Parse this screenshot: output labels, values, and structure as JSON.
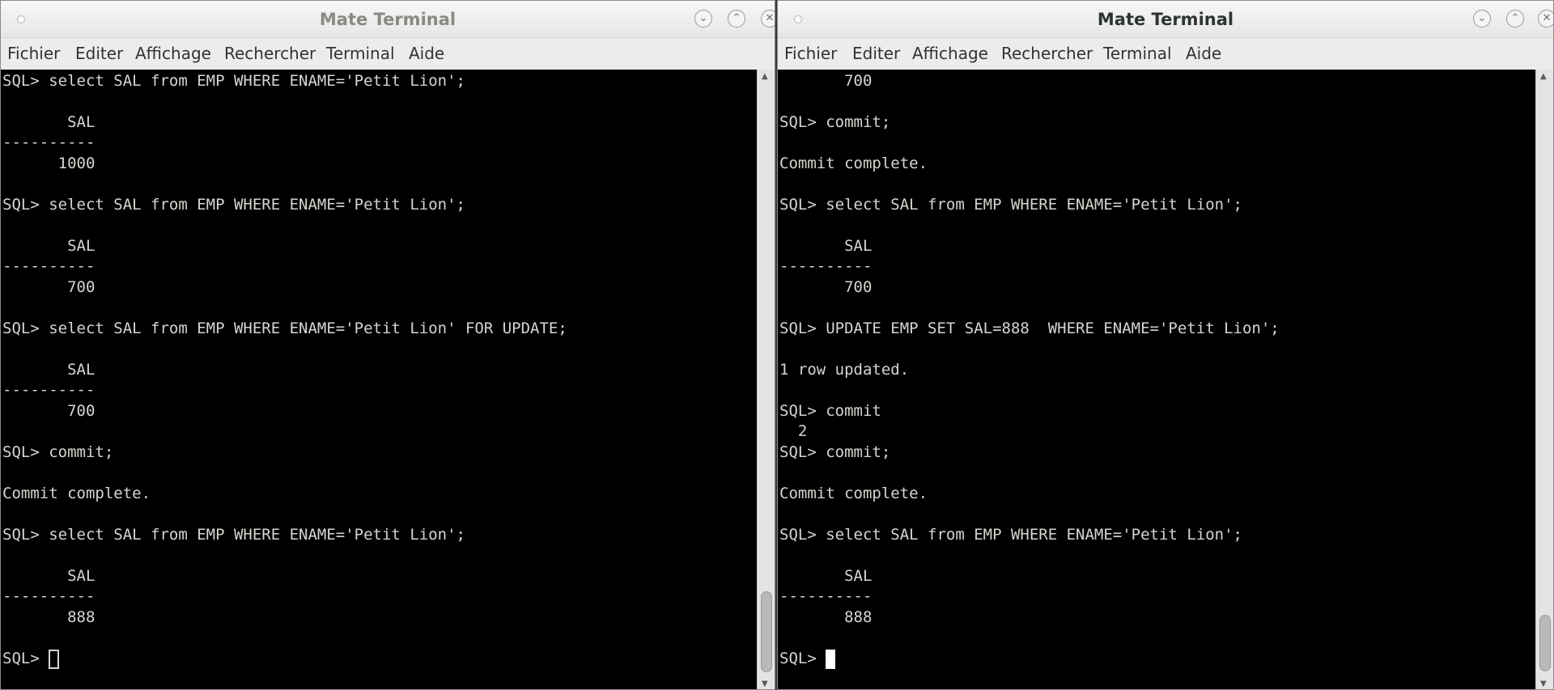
{
  "windows": {
    "left": {
      "title": "Mate Terminal",
      "menu": [
        "Fichier",
        "Editer",
        "Affichage",
        "Rechercher",
        "Terminal",
        "Aide"
      ],
      "lines": [
        "SQL> select SAL from EMP WHERE ENAME='Petit Lion';",
        "",
        "       SAL",
        "----------",
        "      1000",
        "",
        "SQL> select SAL from EMP WHERE ENAME='Petit Lion';",
        "",
        "       SAL",
        "----------",
        "       700",
        "",
        "SQL> select SAL from EMP WHERE ENAME='Petit Lion' FOR UPDATE;",
        "",
        "       SAL",
        "----------",
        "       700",
        "",
        "SQL> commit;",
        "",
        "Commit complete.",
        "",
        "SQL> select SAL from EMP WHERE ENAME='Petit Lion';",
        "",
        "       SAL",
        "----------",
        "       888",
        "",
        "SQL> "
      ]
    },
    "right": {
      "title": "Mate Terminal",
      "menu": [
        "Fichier",
        "Editer",
        "Affichage",
        "Rechercher",
        "Terminal",
        "Aide"
      ],
      "lines": [
        "       700",
        "",
        "SQL> commit;",
        "",
        "Commit complete.",
        "",
        "SQL> select SAL from EMP WHERE ENAME='Petit Lion';",
        "",
        "       SAL",
        "----------",
        "       700",
        "",
        "SQL> UPDATE EMP SET SAL=888  WHERE ENAME='Petit Lion';",
        "",
        "1 row updated.",
        "",
        "SQL> commit",
        "  2",
        "SQL> commit;",
        "",
        "Commit complete.",
        "",
        "SQL> select SAL from EMP WHERE ENAME='Petit Lion';",
        "",
        "       SAL",
        "----------",
        "       888",
        "",
        "SQL> "
      ]
    }
  },
  "icons": {
    "minimize": "chevron-down-icon",
    "maximize": "chevron-up-icon",
    "close": "close-icon",
    "window_menu": "window-menu-dot-icon"
  },
  "colors": {
    "terminal_bg": "#000000",
    "terminal_fg": "#d3d7cf",
    "title_inactive": "#888a85",
    "title_active": "#2e3436"
  }
}
